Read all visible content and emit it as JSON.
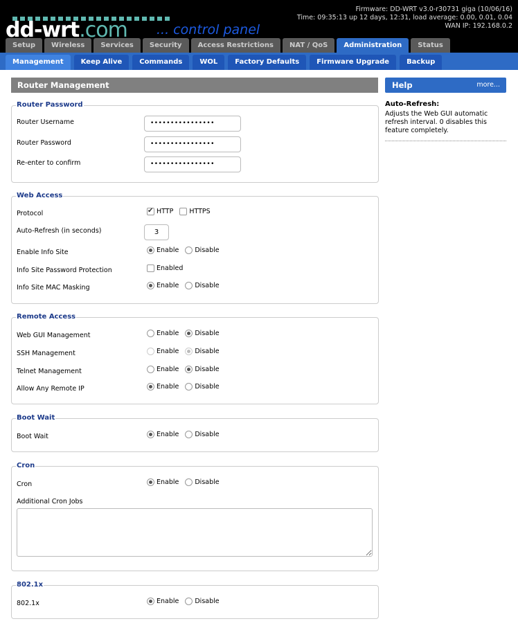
{
  "header": {
    "logo_main": "dd-wrt",
    "logo_com": ".com",
    "logo_sub": "... control panel",
    "firmware": "Firmware: DD-WRT v3.0-r30731 giga (10/06/16)",
    "time": "Time: 09:35:13 up 12 days, 12:31, load average: 0.00, 0.01, 0.04",
    "wan_ip": "WAN IP: 192.168.0.2"
  },
  "main_tabs": [
    "Setup",
    "Wireless",
    "Services",
    "Security",
    "Access Restrictions",
    "NAT / QoS",
    "Administration",
    "Status"
  ],
  "sub_tabs": [
    "Management",
    "Keep Alive",
    "Commands",
    "WOL",
    "Factory Defaults",
    "Firmware Upgrade",
    "Backup"
  ],
  "page_title": "Router Management",
  "help": {
    "title": "Help",
    "more": "more...",
    "heading": "Auto-Refresh:",
    "text": "Adjusts the Web GUI automatic refresh interval. 0 disables this feature completely."
  },
  "router_password": {
    "legend": "Router Password",
    "username_label": "Router Username",
    "username_value": "••••••••••••••••",
    "password_label": "Router Password",
    "password_value": "••••••••••••••••",
    "confirm_label": "Re-enter to confirm",
    "confirm_value": "••••••••••••••••"
  },
  "web_access": {
    "legend": "Web Access",
    "protocol_label": "Protocol",
    "http": "HTTP",
    "https": "HTTPS",
    "autorefresh_label": "Auto-Refresh (in seconds)",
    "autorefresh_value": "3",
    "info_site_label": "Enable Info Site",
    "info_pw_label": "Info Site Password Protection",
    "enabled": "Enabled",
    "mac_label": "Info Site MAC Masking"
  },
  "remote_access": {
    "legend": "Remote Access",
    "webgui_label": "Web GUI Management",
    "ssh_label": "SSH Management",
    "telnet_label": "Telnet Management",
    "anyip_label": "Allow Any Remote IP"
  },
  "boot_wait": {
    "legend": "Boot Wait",
    "label": "Boot Wait"
  },
  "cron": {
    "legend": "Cron",
    "label": "Cron",
    "jobs_label": "Additional Cron Jobs"
  },
  "dot1x": {
    "legend": "802.1x",
    "label": "802.1x"
  },
  "opts": {
    "enable": "Enable",
    "disable": "Disable"
  }
}
